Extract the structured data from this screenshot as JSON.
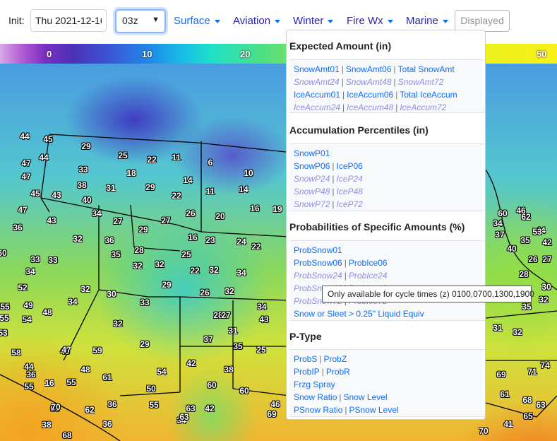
{
  "toolbar": {
    "init_label": "Init:",
    "date_value": "Thu 2021-12-16",
    "cycle_value": "03z",
    "menus": [
      "Surface",
      "Aviation",
      "Winter",
      "Fire Wx",
      "Marine"
    ],
    "displayed_label": "Displayed"
  },
  "colorbar": {
    "ticks": [
      "0",
      "10",
      "20",
      "50"
    ]
  },
  "map": {
    "temps": [
      "44",
      "45",
      "44",
      "47",
      "47",
      "29",
      "25",
      "22",
      "11",
      "6",
      "10",
      "33",
      "18",
      "45",
      "43",
      "38",
      "31",
      "29",
      "14",
      "11",
      "14",
      "40",
      "22",
      "47",
      "34",
      "26",
      "20",
      "16",
      "19",
      "43",
      "36",
      "27",
      "29",
      "27",
      "36",
      "32",
      "16",
      "23",
      "24",
      "22",
      "60",
      "33",
      "33",
      "34",
      "35",
      "28",
      "25",
      "32",
      "32",
      "22",
      "32",
      "34",
      "29",
      "52",
      "32",
      "30",
      "26",
      "32",
      "33",
      "55",
      "49",
      "55",
      "54",
      "48",
      "34",
      "32",
      "28",
      "27",
      "34",
      "43",
      "53",
      "58",
      "48",
      "29",
      "31",
      "37",
      "35",
      "25",
      "44",
      "47",
      "59",
      "48",
      "61",
      "54",
      "42",
      "38",
      "36",
      "16",
      "55",
      "50",
      "55",
      "36",
      "60",
      "42",
      "62",
      "55",
      "60",
      "34",
      "46",
      "38",
      "36",
      "69",
      "61",
      "65",
      "41",
      "63",
      "68",
      "70",
      "69",
      "71",
      "74",
      "70",
      "68",
      "63",
      "63",
      "60",
      "60",
      "46",
      "44",
      "62",
      "53",
      "40",
      "42",
      "35",
      "27",
      "26",
      "28",
      "30",
      "31",
      "32",
      "32",
      "35",
      "34",
      "37",
      "37",
      "41",
      "45",
      "44",
      "43",
      "45",
      "43",
      "47"
    ]
  },
  "dropdown": {
    "sections": [
      {
        "title": "Expected Amount (in)",
        "rows": [
          [
            {
              "t": "SnowAmt01",
              "e": true
            },
            {
              "t": "SnowAmt06",
              "e": true
            },
            {
              "t": "Total SnowAmt",
              "e": true
            }
          ],
          [
            {
              "t": "SnowAmt24",
              "e": false
            },
            {
              "t": "SnowAmt48",
              "e": false
            },
            {
              "t": "SnowAmt72",
              "e": false
            }
          ],
          [
            {
              "t": "IceAccum01",
              "e": true
            },
            {
              "t": "IceAccum06",
              "e": true
            },
            {
              "t": "Total IceAccum",
              "e": true
            }
          ],
          [
            {
              "t": "IceAccum24",
              "e": false
            },
            {
              "t": "IceAccum48",
              "e": false
            },
            {
              "t": "IceAccum72",
              "e": false
            }
          ]
        ]
      },
      {
        "title": "Accumulation Percentiles (in)",
        "rows": [
          [
            {
              "t": "SnowP01",
              "e": true
            }
          ],
          [
            {
              "t": "SnowP06",
              "e": true
            },
            {
              "t": "IceP06",
              "e": true
            }
          ],
          [
            {
              "t": "SnowP24",
              "e": false
            },
            {
              "t": "IceP24",
              "e": false
            }
          ],
          [
            {
              "t": "SnowP48",
              "e": false
            },
            {
              "t": "IceP48",
              "e": false
            }
          ],
          [
            {
              "t": "SnowP72",
              "e": false
            },
            {
              "t": "IceP72",
              "e": false
            }
          ]
        ]
      },
      {
        "title": "Probabilities of Specific Amounts (%)",
        "rows": [
          [
            {
              "t": "ProbSnow01",
              "e": true
            }
          ],
          [
            {
              "t": "ProbSnow06",
              "e": true
            },
            {
              "t": "ProbIce06",
              "e": true
            }
          ],
          [
            {
              "t": "ProbSnow24",
              "e": false
            },
            {
              "t": "ProbIce24",
              "e": false
            }
          ],
          [
            {
              "t": "ProbSnow48",
              "e": false
            },
            {
              "t": "ProbIce48",
              "e": false
            }
          ],
          [
            {
              "t": "ProbSnow72",
              "e": false
            },
            {
              "t": "ProbIce72",
              "e": false
            }
          ],
          [
            {
              "t": "Snow or Sleet > 0.25\" Liquid Equiv",
              "e": true
            }
          ]
        ]
      },
      {
        "title": "P-Type",
        "rows": [
          [
            {
              "t": "ProbS",
              "e": true
            },
            {
              "t": "ProbZ",
              "e": true
            }
          ],
          [
            {
              "t": "ProbIP",
              "e": true
            },
            {
              "t": "ProbR",
              "e": true
            }
          ],
          [
            {
              "t": "Frzg Spray",
              "e": true
            }
          ],
          [
            {
              "t": "Snow Ratio",
              "e": true
            },
            {
              "t": "Snow Level",
              "e": true
            }
          ],
          [
            {
              "t": "PSnow Ratio",
              "e": true
            },
            {
              "t": "PSnow Level",
              "e": true
            }
          ]
        ]
      }
    ]
  },
  "tooltip": {
    "text": "Only available for cycle times (z) 0100,0700,1300,1900"
  }
}
